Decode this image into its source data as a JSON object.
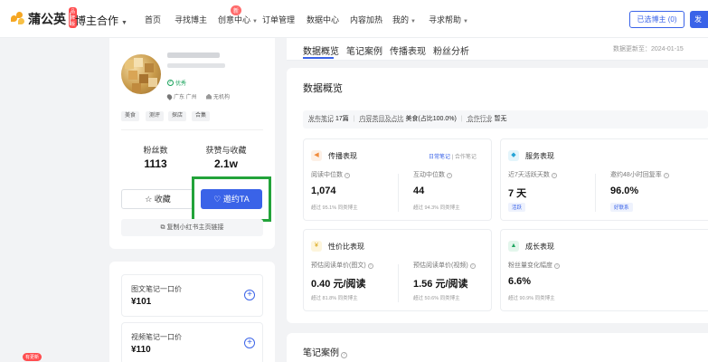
{
  "header": {
    "logo_text": "蒲公英",
    "logo_badge": "品牌版",
    "role": "博主合作",
    "nav": [
      {
        "label": "首页"
      },
      {
        "label": "寻找博主"
      },
      {
        "label": "创意中心"
      },
      {
        "label": "订单管理"
      },
      {
        "label": "数据中心"
      },
      {
        "label": "内容加热"
      },
      {
        "label": "我的"
      },
      {
        "label": "寻求帮助"
      }
    ],
    "nav_badge": "新",
    "selected_button": "已选博主 (0)",
    "edge_button": "发"
  },
  "profile": {
    "verified_tag": "优秀",
    "location": "广东 广州",
    "agency": "无机构",
    "tags": [
      "美食",
      "测评",
      "探店",
      "合集"
    ],
    "stats": [
      {
        "label": "粉丝数",
        "value": "1113"
      },
      {
        "label": "获赞与收藏",
        "value": "2.1w"
      }
    ],
    "collect_button": "收藏",
    "invite_button": "邀约TA",
    "copy_link": "复制小红书主页链接"
  },
  "prices": [
    {
      "title": "图文笔记一口价",
      "value": "¥101"
    },
    {
      "title": "视频笔记一口价",
      "value": "¥110"
    }
  ],
  "new_badge": "有更新",
  "tabs": [
    {
      "label": "数据概览"
    },
    {
      "label": "笔记案例"
    },
    {
      "label": "传播表现"
    },
    {
      "label": "粉丝分析"
    }
  ],
  "update_time": "数据更新至：2024-01-15",
  "overview": {
    "title": "数据概览",
    "summary": {
      "k1": "发布笔记",
      "v1": "17篇",
      "k2": "内容类目及占比",
      "v2": "美食(占比100.0%)",
      "k3": "合作行业",
      "v3": "暂无"
    },
    "spread": {
      "title": "传播表现",
      "link_daily": "日常笔记",
      "link_coop": "合作笔记",
      "metrics": [
        {
          "label": "阅读中位数",
          "value": "1,074",
          "sub": "超过 95.1% 同类博主"
        },
        {
          "label": "互动中位数",
          "value": "44",
          "sub": "超过 94.3% 同类博主"
        }
      ]
    },
    "service": {
      "title": "服务表现",
      "metrics": [
        {
          "label": "近7天活跃天数",
          "value": "7 天",
          "pill": "活跃"
        },
        {
          "label": "邀约48小时回复率",
          "value": "96.0%",
          "pill": "好联系"
        }
      ]
    },
    "cost": {
      "title": "性价比表现",
      "metrics": [
        {
          "label": "预估阅读单价(图文)",
          "value": "0.40 元/阅读",
          "sub": "超过 81.8% 同类博主"
        },
        {
          "label": "预估阅读单价(视频)",
          "value": "1.56 元/阅读",
          "sub": "超过 50.6% 同类博主"
        }
      ]
    },
    "growth": {
      "title": "成长表现",
      "metrics": [
        {
          "label": "粉丝量变化幅度",
          "value": "6.6%",
          "sub": "超过 90.9% 同类博主"
        }
      ]
    }
  },
  "notes_section": {
    "title": "笔记案例"
  },
  "colors": {
    "accent": "#3a63e8",
    "highlight": "#22a33a",
    "bg": "#f2f3f5"
  }
}
